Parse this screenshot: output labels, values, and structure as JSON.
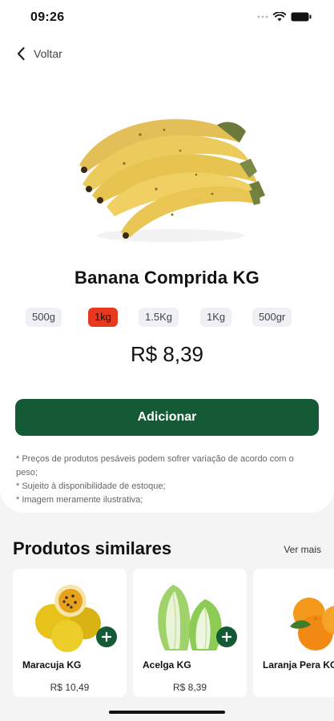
{
  "status_bar": {
    "time": "09:26"
  },
  "nav": {
    "back_label": "Voltar"
  },
  "product": {
    "title": "Banana Comprida KG",
    "weight_options": [
      "500g",
      "1kg",
      "1.5Kg",
      "1Kg",
      "500gr"
    ],
    "selected_weight": "1kg",
    "price": "R$ 8,39",
    "add_button_label": "Adicionar",
    "disclaimers": [
      "* Preços de produtos pesáveis podem sofrer variação de acordo com o peso;",
      "* Sujeito à disponibilidade de estoque;",
      "* Imagem meramente ilustrativa;"
    ]
  },
  "similar": {
    "title": "Produtos similares",
    "see_more_label": "Ver mais",
    "items": [
      {
        "name": "Maracuja KG",
        "price": "R$ 10,49",
        "icon": "passion-fruit-icon"
      },
      {
        "name": "Acelga KG",
        "price": "R$ 8,39",
        "icon": "napa-cabbage-icon"
      },
      {
        "name": "Laranja Pera KG",
        "price": "",
        "icon": "orange-icon"
      }
    ]
  },
  "colors": {
    "accent_green": "#155a36",
    "selected_chip": "#e8381f",
    "chip_background": "#eef0f4",
    "page_background": "#f4f4f4"
  }
}
